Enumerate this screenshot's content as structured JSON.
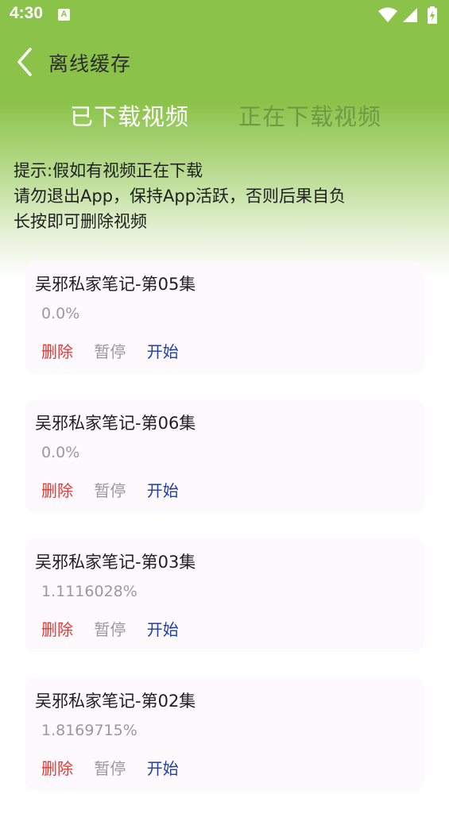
{
  "status_bar": {
    "time": "4:30",
    "a_icon": "A",
    "icons": [
      "wifi-icon",
      "signal-icon",
      "battery-icon"
    ]
  },
  "nav": {
    "title": "离线缓存",
    "back_icon": "chevron-left-icon"
  },
  "tabs": [
    {
      "label": "已下载视频",
      "selected": true
    },
    {
      "label": "正在下载视频",
      "selected": false
    }
  ],
  "tips": {
    "line1": "提示:假如有视频正在下载",
    "line2": "请勿退出App，保持App活跃，否则后果自负",
    "line3": "长按即可删除视频"
  },
  "downloads": [
    {
      "title": "吴邪私家笔记-第05集",
      "progress": "0.0%"
    },
    {
      "title": "吴邪私家笔记-第06集",
      "progress": "0.0%"
    },
    {
      "title": "吴邪私家笔记-第03集",
      "progress": "1.1116028%"
    },
    {
      "title": "吴邪私家笔记-第02集",
      "progress": "1.8169715%"
    }
  ],
  "actions": {
    "delete": "删除",
    "pause": "暂停",
    "start": "开始"
  },
  "colors": {
    "header_green": "#8bc34a",
    "delete_red": "#e53935",
    "start_blue": "#1f3fa3",
    "muted_gray": "#9a9a9a"
  }
}
